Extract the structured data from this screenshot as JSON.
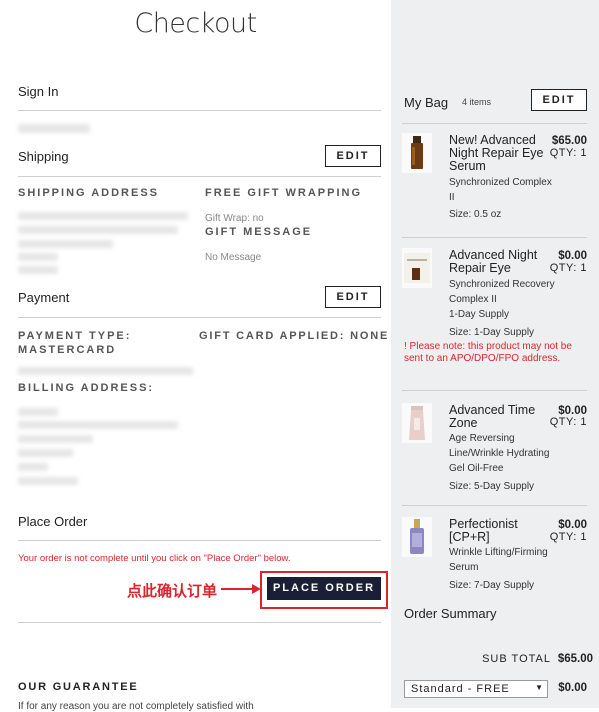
{
  "page": {
    "title": "Checkout"
  },
  "sign_in": {
    "label": "Sign In"
  },
  "shipping": {
    "label": "Shipping",
    "edit_label": "EDIT",
    "address_header": "SHIPPING ADDRESS",
    "gift_wrap_header": "FREE GIFT WRAPPING",
    "gift_wrap_value": "Gift Wrap: no",
    "gift_message_header": "GIFT MESSAGE",
    "gift_message_value": "No Message"
  },
  "payment": {
    "label": "Payment",
    "edit_label": "EDIT",
    "type_line1": "PAYMENT TYPE:",
    "type_line2": "MASTERCARD",
    "gift_card": "GIFT CARD APPLIED: NONE",
    "billing_header": "BILLING ADDRESS:"
  },
  "place_order": {
    "label": "Place Order",
    "warning": "Your order is not complete until you click on \"Place Order\" below.",
    "button_label": "PLACE ORDER",
    "annotation": "点此确认订单"
  },
  "guarantee": {
    "header": "OUR GUARANTEE",
    "text": "If for any reason you are not completely satisfied with"
  },
  "bag": {
    "title": "My Bag",
    "count": "4 items",
    "edit_label": "EDIT",
    "items": [
      {
        "name": "New! Advanced Night Repair Eye Serum",
        "price": "$65.00",
        "qty": "QTY: 1",
        "desc": "Synchronized Complex II",
        "size": "Size: 0.5 oz"
      },
      {
        "name": "Advanced Night Repair Eye",
        "price": "$0.00",
        "qty": "QTY: 1",
        "desc": "Synchronized Recovery Complex II",
        "desc2": "1-Day Supply",
        "size": "Size: 1-Day Supply",
        "note": "! Please note: this product may not be sent to an APO/DPO/FPO address."
      },
      {
        "name": "Advanced Time Zone",
        "price": "$0.00",
        "qty": "QTY: 1",
        "desc": "Age Reversing Line/Wrinkle Hydrating Gel Oil-Free",
        "size": "Size: 5-Day Supply"
      },
      {
        "name": "Perfectionist [CP+R]",
        "price": "$0.00",
        "qty": "QTY: 1",
        "desc": "Wrinkle Lifting/Firming Serum",
        "size": "Size: 7-Day Supply"
      }
    ]
  },
  "summary": {
    "title": "Order Summary",
    "subtotal_label": "SUB TOTAL",
    "subtotal_value": "$65.00",
    "shipping_option": "Standard - FREE",
    "shipping_value": "$0.00"
  },
  "colors": {
    "accent_red": "#d9262c",
    "button_navy": "#1a1f36",
    "sidebar_bg": "#eeeff1"
  }
}
